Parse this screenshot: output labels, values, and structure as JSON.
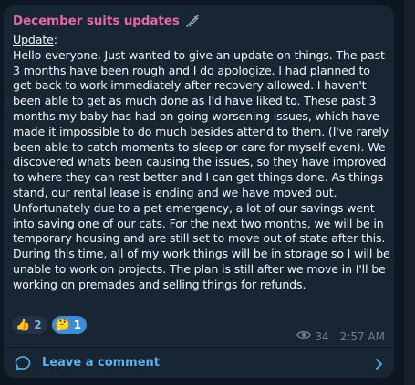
{
  "post": {
    "channel_name": "December suits updates",
    "update_label": "Update",
    "update_colon": ":",
    "paragraph": "Hello everyone. Just wanted to give an update on things. The past 3 months have been rough and I do apologize. I had planned to get back to work immediately after recovery allowed. I haven't been able to get as much done as I'd have liked to. These past 3 months my baby has had on going worsening issues, which have made it impossible to do much besides attend to them. (I've rarely been able to catch moments to sleep or care for myself even). We discovered whats been causing the issues, so they have improved to where they can rest better and I can get things done. As things stand, our rental lease is ending and we have moved out. Unfortunately due to a pet emergency, a lot of our savings went into saving one of our cats. For the next two months, we will be in temporary housing and are still set to move out of state after this. During this time, all of my work things will be in storage so I will be unable to work on projects. The plan is still after we move in I'll be working on premades and selling things for refunds."
  },
  "reactions": [
    {
      "emoji": "👍",
      "count": "2",
      "icon": "thumbs-up-emoji"
    },
    {
      "emoji": "🤔",
      "count": "1",
      "icon": "thinking-face-emoji"
    }
  ],
  "meta": {
    "views": "34",
    "time": "2:57 AM",
    "views_icon": "eye-icon"
  },
  "comments": {
    "label": "Leave a comment",
    "icon": "comment-bubble-icon",
    "chevron_icon": "chevron-right-icon"
  },
  "colors": {
    "background": "#0e1621",
    "bubble": "#182533",
    "channel_name": "#e56aa0",
    "accent": "#5eb1ef",
    "meta": "#6d7f8f",
    "active_reaction": "#3b8ed6"
  }
}
